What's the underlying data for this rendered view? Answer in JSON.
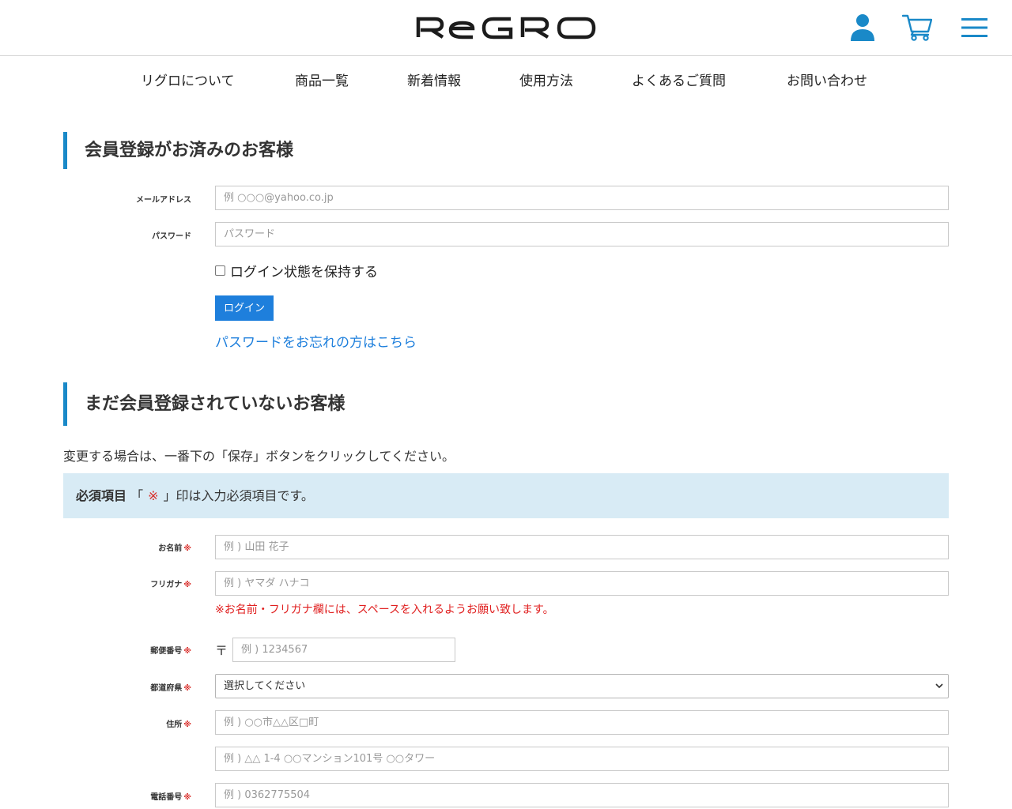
{
  "header": {
    "logo_text": "REGRO",
    "accent_color": "#1a89c8",
    "icons": [
      "user-icon",
      "cart-icon",
      "menu-icon"
    ]
  },
  "nav": {
    "items": [
      "リグロについて",
      "商品一覧",
      "新着情報",
      "使用方法",
      "よくあるご質問",
      "お問い合わせ"
    ]
  },
  "login": {
    "heading": "会員登録がお済みのお客様",
    "email_label": "メールアドレス",
    "email_placeholder": "例 ○○○@yahoo.co.jp",
    "password_label": "パスワード",
    "password_placeholder": "パスワード",
    "remember_label": "ログイン状態を保持する",
    "login_button": "ログイン",
    "forgot_link": "パスワードをお忘れの方はこちら"
  },
  "register": {
    "heading": "まだ会員登録されていないお客様",
    "intro": "変更する場合は、一番下の「保存」ボタンをクリックしてください。",
    "notice_bold": "必須項目",
    "notice_open": "「",
    "notice_mark": "※",
    "notice_rest": "」印は入力必須項目です。",
    "required_mark": "※",
    "name_label": "お名前",
    "name_placeholder": "例 ) 山田 花子",
    "kana_label": "フリガナ",
    "kana_placeholder": "例 ) ヤマダ ハナコ",
    "kana_note": "※お名前・フリガナ欄には、スペースを入れるようお願い致します。",
    "zip_label": "郵便番号",
    "zip_symbol": "〒",
    "zip_placeholder": "例 ) 1234567",
    "pref_label": "都道府県",
    "pref_selected": "選択してください",
    "address_label": "住所",
    "address1_placeholder": "例 ) ○○市△△区□町",
    "address2_placeholder": "例 ) △△ 1-4 ○○マンション101号 ○○タワー",
    "phone_label": "電話番号",
    "phone_placeholder": "例 ) 0362775504"
  }
}
